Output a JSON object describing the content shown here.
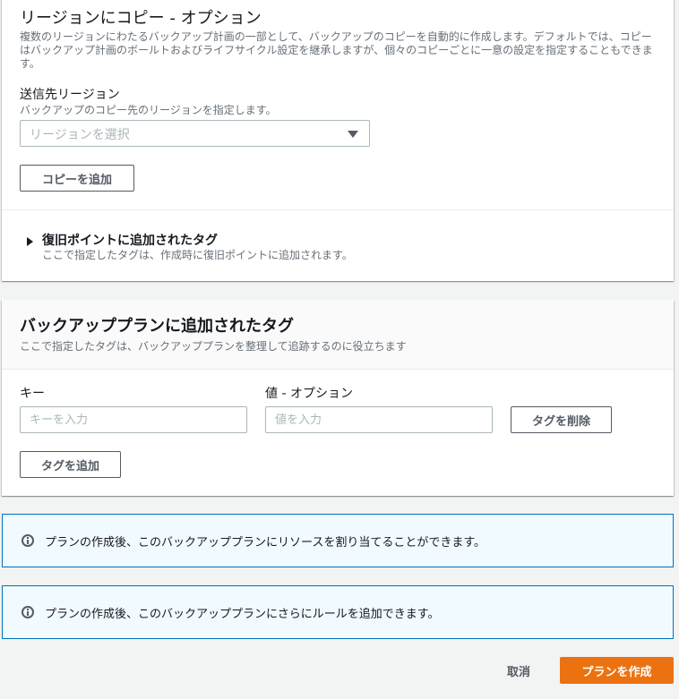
{
  "copy_section": {
    "title": "リージョンにコピー - オプション",
    "description": "複数のリージョンにわたるバックアップ計画の一部として、バックアップのコピーを自動的に作成します。デフォルトでは、コピーはバックアップ計画のボールトおよびライフサイクル設定を継承しますが、個々のコピーごとに一意の設定を指定することもできます。",
    "destination_label": "送信先リージョン",
    "destination_help": "バックアップのコピー先のリージョンを指定します。",
    "region_select_placeholder": "リージョンを選択",
    "add_copy_button": "コピーを追加",
    "recovery_tags_title": "復旧ポイントに追加されたタグ",
    "recovery_tags_desc": "ここで指定したタグは、作成時に復旧ポイントに追加されます。"
  },
  "plan_tags_section": {
    "title": "バックアッププランに追加されたタグ",
    "description": "ここで指定したタグは、バックアッププランを整理して追跡するのに役立ちます",
    "key_label": "キー",
    "key_placeholder": "キーを入力",
    "value_label": "値 - オプション",
    "value_placeholder": "値を入力",
    "remove_tag_button": "タグを削除",
    "add_tag_button": "タグを追加"
  },
  "info_messages": [
    {
      "icon": "info-icon",
      "text": "プランの作成後、このバックアッププランにリソースを割り当てることができます。"
    },
    {
      "icon": "info-icon",
      "text": "プランの作成後、このバックアッププランにさらにルールを追加できます。"
    }
  ],
  "footer": {
    "cancel_label": "取消",
    "create_label": "プランを作成"
  },
  "colors": {
    "primary_orange": "#ec7211",
    "info_border": "#0073bb",
    "info_bg": "#f1faff",
    "page_bg": "#f2f3f3"
  }
}
